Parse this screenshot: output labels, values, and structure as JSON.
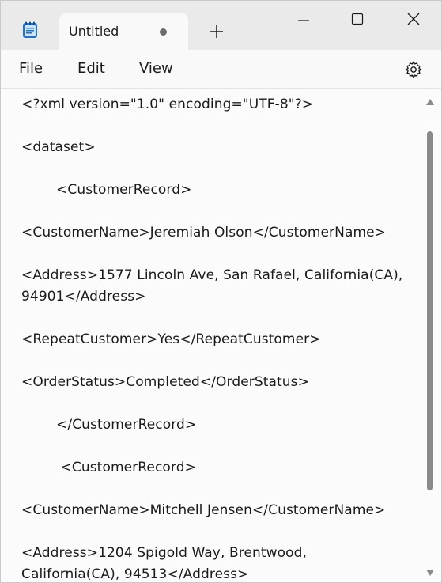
{
  "tab": {
    "title": "Untitled",
    "unsaved_indicator": "modified-dot-icon"
  },
  "menu": {
    "file": "File",
    "edit": "Edit",
    "view": "View"
  },
  "editor": {
    "lines": [
      "<?xml version=\"1.0\" encoding=\"UTF-8\"?>",
      "<dataset>",
      "        <CustomerRecord>",
      "<CustomerName>Jeremiah Olson</CustomerName>",
      "<Address>1577 Lincoln Ave, San Rafael, California(CA),",
      "94901</Address>",
      "<RepeatCustomer>Yes</RepeatCustomer>",
      "<OrderStatus>Completed</OrderStatus>",
      "        </CustomerRecord>",
      "         <CustomerRecord>",
      "<CustomerName>Mitchell Jensen</CustomerName>",
      "<Address>1204 Spigold Way, Brentwood,",
      "California(CA), 94513</Address>"
    ]
  },
  "colors": {
    "titlebar": "#eaeaea",
    "tab": "#f9f9f9",
    "editor_bg": "#fbfbfb",
    "text": "#1a1a1a",
    "app_icon_blue": "#1e73c8"
  }
}
